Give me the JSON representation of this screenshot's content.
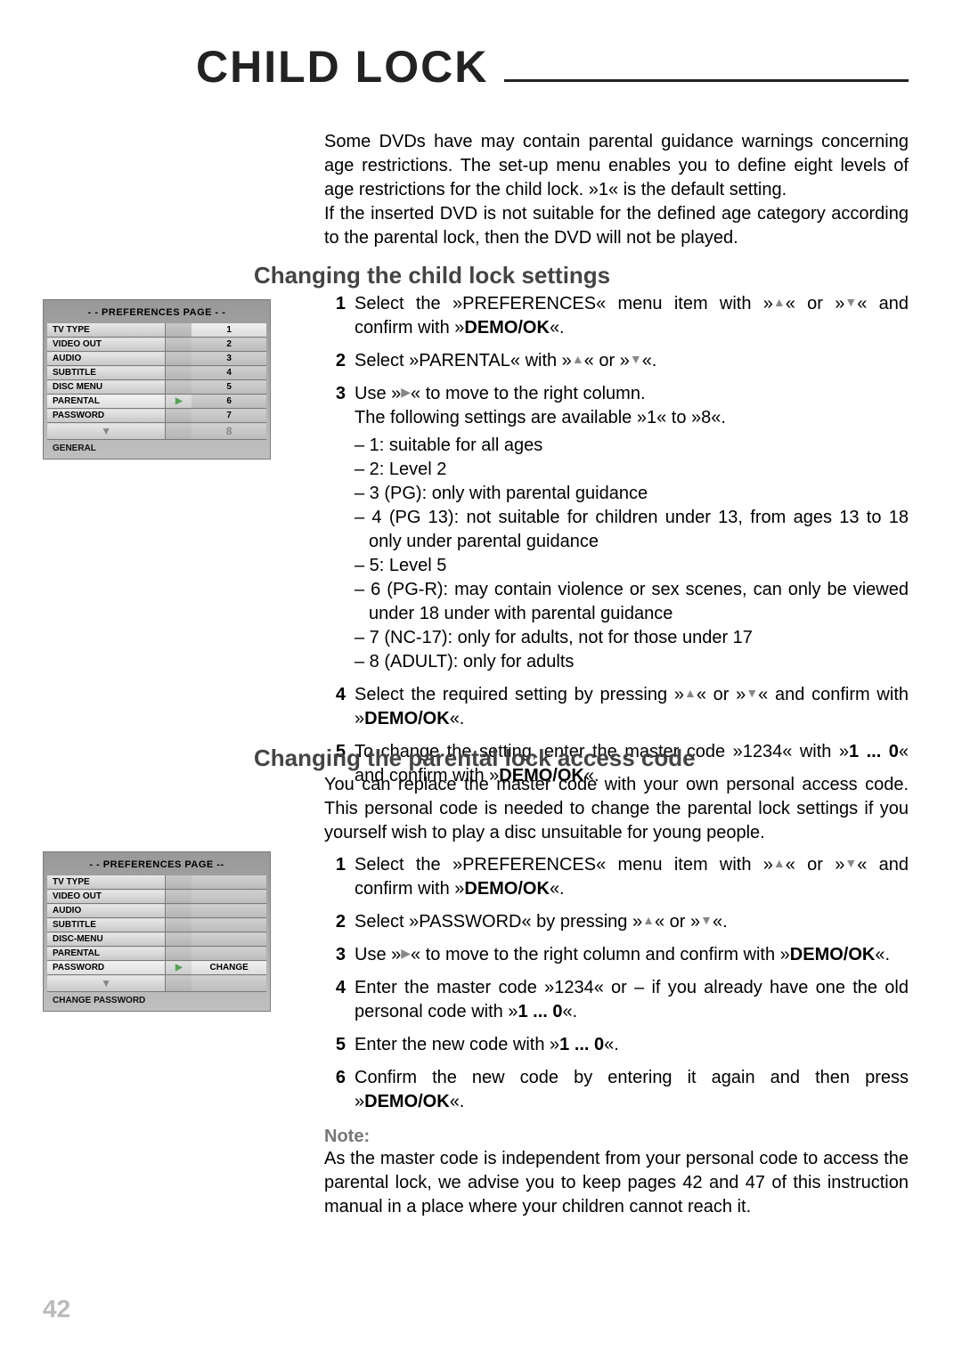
{
  "page_number": "42",
  "title": "CHILD LOCK",
  "intro": "Some DVDs have may contain parental guidance warnings concerning age restrictions. The set-up menu enables you to define eight levels of age restrictions for the child lock. »1« is the default setting.\nIf the inserted DVD is not suitable for the defined age category according to the parental lock, then the DVD will not be played.",
  "symbols": {
    "up": "▲",
    "down": "▼",
    "right": "▶"
  },
  "section1": {
    "heading": "Changing the child lock settings",
    "steps": {
      "s1_num": "1",
      "s1_a": "Select the »PREFERENCES« menu item with »",
      "s1_b": "« or »",
      "s1_c": "« and confirm with »",
      "s1_d": "DEMO/OK",
      "s1_e": "«.",
      "s2_num": "2",
      "s2_a": "Select »PARENTAL« with »",
      "s2_b": "« or »",
      "s2_c": "«.",
      "s3_num": "3",
      "s3_a": "Use »",
      "s3_b": "« to move to the right column.",
      "s3_follow": "The following settings are available »1« to »8«.",
      "s3_l1": "– 1: suitable for all ages",
      "s3_l2": "– 2: Level 2",
      "s3_l3": "– 3 (PG): only with parental guidance",
      "s3_l4": "– 4 (PG 13): not suitable for children under 13, from ages 13 to 18 only under parental guidance",
      "s3_l5": "– 5: Level 5",
      "s3_l6": "– 6 (PG-R): may contain violence or sex scenes, can only be viewed under 18 under with parental guidance",
      "s3_l7": "– 7 (NC-17): only for adults, not for those under 17",
      "s3_l8": "– 8 (ADULT): only for adults",
      "s4_num": "4",
      "s4_a": "Select the required setting by pressing »",
      "s4_b": "« or »",
      "s4_c": "« and confirm with »",
      "s4_d": "DEMO/OK",
      "s4_e": "«.",
      "s5_num": "5",
      "s5_a": "To change the setting, enter the master code »1234« with »",
      "s5_b": "1 ... 0",
      "s5_c": "« and confirm with »",
      "s5_d": "DEMO/OK",
      "s5_e": "«."
    }
  },
  "section2": {
    "heading": "Changing the parental lock access code",
    "intro": "You can replace the master code with your own personal access code. This personal code is needed to change the parental lock settings if you yourself wish to play a disc unsuitable for young people.",
    "steps": {
      "s1_num": "1",
      "s1_a": "Select the »PREFERENCES« menu item with »",
      "s1_b": "« or »",
      "s1_c": "« and confirm with »",
      "s1_d": "DEMO/OK",
      "s1_e": "«.",
      "s2_num": "2",
      "s2_a": "Select »PASSWORD« by pressing »",
      "s2_b": "« or »",
      "s2_c": "«.",
      "s3_num": "3",
      "s3_a": "Use »",
      "s3_b": "« to move to the right column and confirm with »",
      "s3_c": "DEMO/OK",
      "s3_d": "«.",
      "s4_num": "4",
      "s4_a": "Enter the master code »1234« or – if you already have one the old personal code with »",
      "s4_b": "1 ... 0",
      "s4_c": "«.",
      "s5_num": "5",
      "s5_a": "Enter the new code with »",
      "s5_b": "1 ... 0",
      "s5_c": "«.",
      "s6_num": "6",
      "s6_a": "Confirm the new code by entering it again and then press »",
      "s6_b": "DEMO/OK",
      "s6_c": "«."
    },
    "note_label": "Note:",
    "note_body": "As the master code is independent from your personal code to access the parental lock, we advise you to keep pages 42 and 47 of this instruction manual in a place where your children cannot reach it."
  },
  "menu1": {
    "title": "- - PREFERENCES PAGE - -",
    "footer": "GENERAL",
    "rows": [
      {
        "left": "TV TYPE",
        "right": "1"
      },
      {
        "left": "VIDEO OUT",
        "right": "2"
      },
      {
        "left": "AUDIO",
        "right": "3"
      },
      {
        "left": "SUBTITLE",
        "right": "4"
      },
      {
        "left": "DISC MENU",
        "right": "5"
      },
      {
        "left": "PARENTAL",
        "right": "6"
      },
      {
        "left": "PASSWORD",
        "right": "7"
      },
      {
        "left": "",
        "right": "8"
      }
    ],
    "highlight_index": 5
  },
  "menu2": {
    "title": "- - PREFERENCES PAGE --",
    "footer": "CHANGE PASSWORD",
    "change_label": "CHANGE",
    "rows": [
      {
        "left": "TV TYPE"
      },
      {
        "left": "VIDEO OUT"
      },
      {
        "left": "AUDIO"
      },
      {
        "left": "SUBTITLE"
      },
      {
        "left": "DISC-MENU"
      },
      {
        "left": "PARENTAL"
      },
      {
        "left": "PASSWORD"
      }
    ],
    "highlight_index": 6
  }
}
